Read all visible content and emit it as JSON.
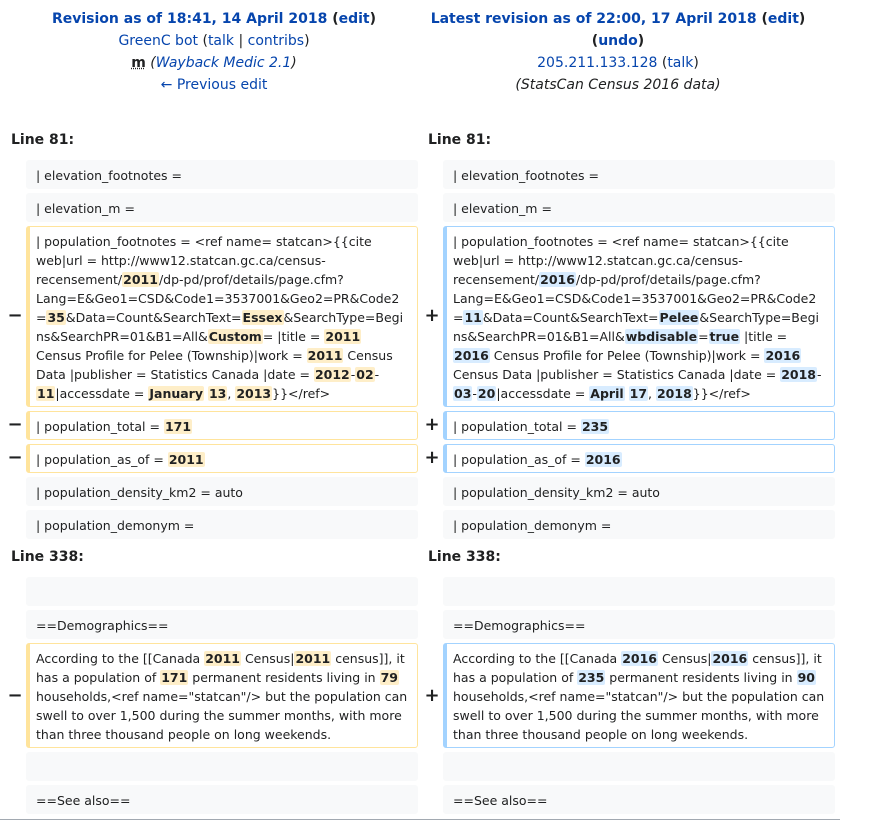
{
  "left_header": {
    "title": "Revision as of 18:41, 14 April 2018",
    "edit": "edit",
    "user": "GreenC bot",
    "talk": "talk",
    "contribs": "contribs",
    "minor": "m",
    "summary": "Wayback Medic 2.1",
    "prev": "← Previous edit"
  },
  "right_header": {
    "title": "Latest revision as of 22:00, 17 April 2018",
    "edit": "edit",
    "undo": "undo",
    "user": "205.211.133.128",
    "talk": "talk",
    "summary": "(StatsCan Census 2016 data)"
  },
  "sections": [
    {
      "line_left": "Line 81:",
      "line_right": "Line 81:"
    },
    {
      "line_left": "Line 338:",
      "line_right": "Line 338:"
    }
  ],
  "markers": {
    "minus": "−",
    "plus": "+"
  },
  "context": {
    "elev_foot": "| elevation_footnotes     =",
    "elev_m": "| elevation_m             =",
    "density": "| population_density_km2  = auto",
    "demonym": "| population_demonym      =",
    "blank": "",
    "demographics": "==Demographics==",
    "see_also": "==See also=="
  },
  "left": {
    "footnotes": [
      "| population_footnotes    = <ref name= statcan>{{cite web|url = http://www12.statcan.gc.ca/census-recensement/",
      "2011",
      "/dp-pd/prof/details/page.cfm?Lang=E&Geo1=CSD&Code1=3537001&Geo2=PR&Code2=",
      "35",
      "&Data=Count&SearchText=",
      "Essex",
      "&SearchType=Begins&SearchPR=01&B1=All&",
      "Custom",
      "= |title = ",
      "2011",
      " Census Profile for Pelee (Township)|work = ",
      "2011",
      " Census Data |publisher = Statistics Canada |date = ",
      "2012",
      "-",
      "02",
      "-",
      "11",
      "|accessdate = ",
      "January",
      " ",
      "13",
      ", ",
      "2013",
      "}}</ref>"
    ],
    "total": [
      "| population_total        = ",
      "171"
    ],
    "as_of": [
      "| population_as_of        = ",
      "2011"
    ],
    "demo_para": [
      "According to the [[Canada ",
      "2011",
      " Census|",
      "2011",
      " census]], it has a population of ",
      "171",
      " permanent residents living in ",
      "79",
      " households,<ref name=\"statcan\"/> but the population can swell to over 1,500 during the summer months, with more than three thousand people on long weekends."
    ]
  },
  "right": {
    "footnotes": [
      "| population_footnotes    = <ref name= statcan>{{cite web|url = http://www12.statcan.gc.ca/census-recensement/",
      "2016",
      "/dp-pd/prof/details/page.cfm?Lang=E&Geo1=CSD&Code1=3537001&Geo2=PR&Code2=",
      "11",
      "&Data=Count&SearchText=",
      "Pelee",
      "&SearchType=Begins&SearchPR=01&B1=All&",
      "wbdisable",
      "=",
      "true",
      " |title = ",
      "2016",
      " Census Profile for Pelee (Township)|work = ",
      "2016",
      " Census Data |publisher = Statistics Canada |date = ",
      "2018",
      "-",
      "03",
      "-",
      "20",
      "|accessdate = ",
      "April",
      " ",
      "17",
      ", ",
      "2018",
      "}}</ref>"
    ],
    "total": [
      "| population_total        = ",
      "235"
    ],
    "as_of": [
      "| population_as_of        = ",
      "2016"
    ],
    "demo_para": [
      "According to the [[Canada ",
      "2016",
      " Census|",
      "2016",
      " census]], it has a population of ",
      "235",
      " permanent residents living in ",
      "90",
      " households,<ref name=\"statcan\"/> but the population can swell to over 1,500 during the summer months, with more than three thousand people on long weekends."
    ]
  }
}
